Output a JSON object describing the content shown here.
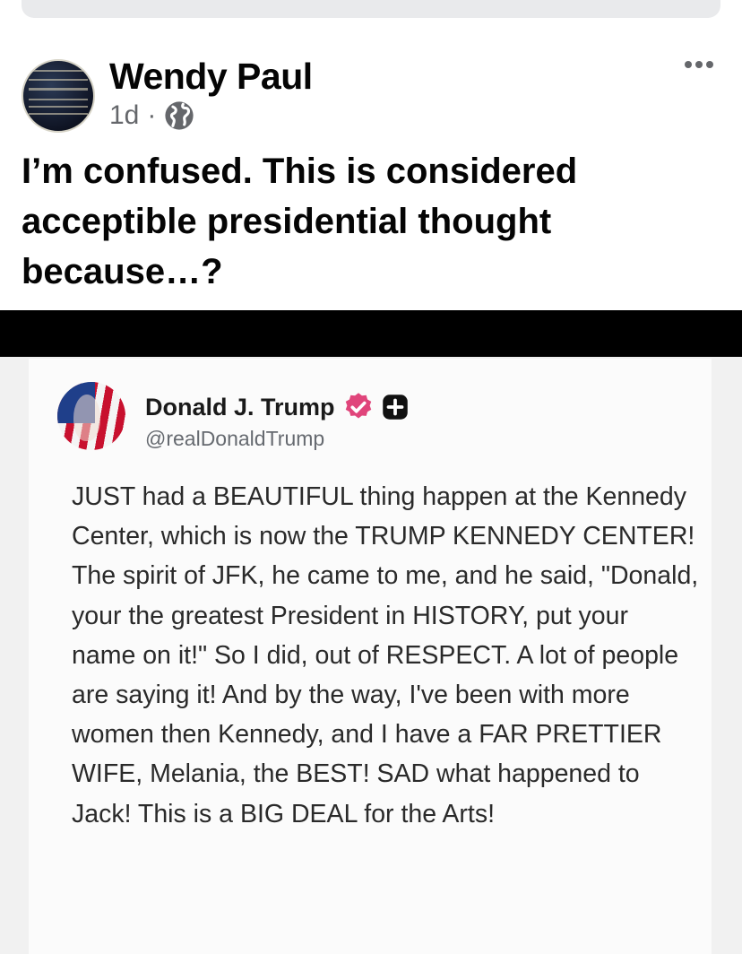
{
  "post": {
    "author_name": "Wendy Paul",
    "time": "1d",
    "separator": "·",
    "text": "I’m confused. This is considered acceptible presidential thought because…?"
  },
  "icons": {
    "avatar": "avatar-image",
    "privacy": "globe-icon",
    "menu": "more-options-icon",
    "verified": "verified-badge-icon",
    "plus": "plus-icon"
  },
  "shared_image": {
    "author_name": "Donald J. Trump",
    "handle": "@realDonaldTrump",
    "body": "JUST had a BEAUTIFUL thing happen at the Kennedy Center, which is now the TRUMP KENNEDY CENTER! The spirit of JFK, he came to me, and he said, \"Donald, your the greatest President in HISTORY, put your name on it!\" So I did, out of RESPECT. A lot of people are saying it! And by the way, I've been with more women then Kennedy, and I have a FAR PRETTIER WIFE, Melania, the BEST! SAD what happened to Jack! This is a BIG DEAL for the Arts!"
  },
  "colors": {
    "text_primary": "#050505",
    "text_secondary": "#65676b",
    "verified_badge": "#e0457b"
  }
}
